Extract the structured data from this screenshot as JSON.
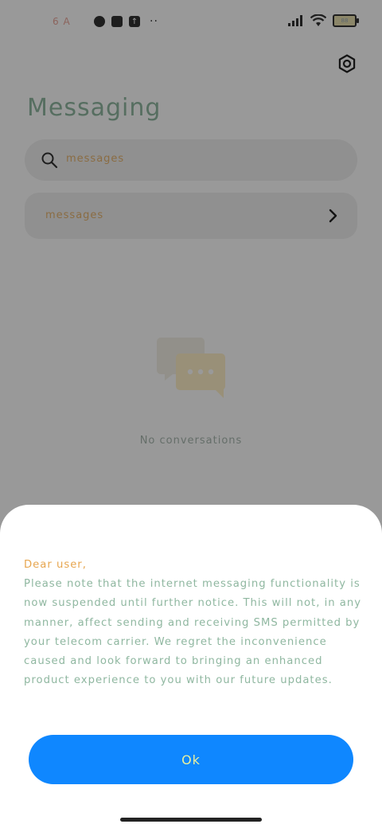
{
  "status_bar": {
    "time": "6 A",
    "battery": "88"
  },
  "app": {
    "title": "Messaging",
    "search": {
      "placeholder": "messages"
    },
    "row": {
      "label": "messages"
    },
    "empty_state": "No conversations"
  },
  "dialog": {
    "greeting": "Dear user,",
    "body": "Please note that the internet messaging functionality is now suspended until further notice. This will not, in any manner, affect sending and receiving SMS permitted by your telecom carrier. We regret the inconvenience caused and look forward to bringing an enhanced product experience to you with our future updates.",
    "ok_label": "Ok"
  },
  "colors": {
    "accent": "#0f87ff",
    "scrim": "rgba(0,0,0,0.4)"
  }
}
